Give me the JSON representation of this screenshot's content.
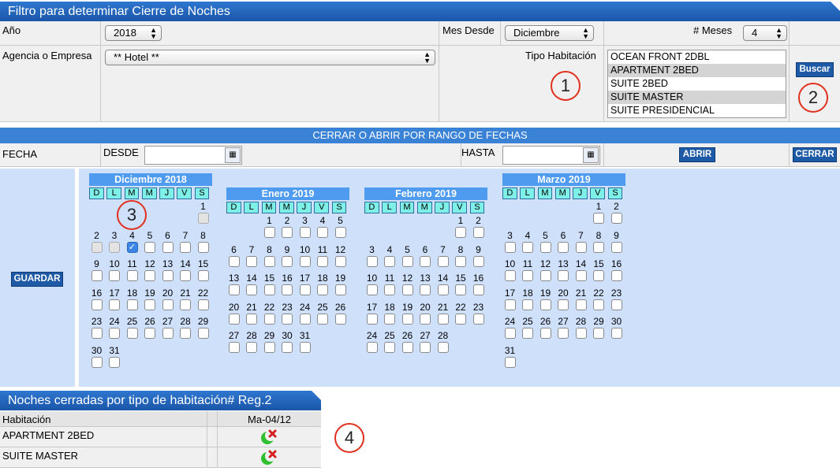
{
  "filter": {
    "title": "Filtro para determinar Cierre de Noches",
    "year_label": "Año",
    "year_value": "2018",
    "month_from_label": "Mes Desde",
    "month_from_value": "Diciembre",
    "months_label": "# Meses",
    "months_value": "4",
    "agency_label": "Agencia o Empresa",
    "agency_value": "** Hotel **",
    "room_type_label": "Tipo Habitación",
    "room_types": [
      {
        "label": "OCEAN FRONT 2DBL",
        "selected": false
      },
      {
        "label": "APARTMENT 2BED",
        "selected": true
      },
      {
        "label": "SUITE 2BED",
        "selected": false
      },
      {
        "label": "SUITE MASTER",
        "selected": true
      },
      {
        "label": "SUITE PRESIDENCIAL",
        "selected": false
      }
    ],
    "search_label": "Buscar"
  },
  "markers": [
    "1",
    "2",
    "3",
    "4"
  ],
  "range": {
    "title": "CERRAR O ABRIR POR RANGO DE FECHAS",
    "date_label": "FECHA",
    "from_label": "DESDE",
    "from_value": "",
    "to_label": "HASTA",
    "to_value": "",
    "open_label": "ABRIR",
    "close_label": "CERRAR"
  },
  "calendar": {
    "save_label": "GUARDAR",
    "dow": [
      "D",
      "L",
      "M",
      "M",
      "J",
      "V",
      "S"
    ],
    "months": [
      {
        "title": "Diciembre 2018",
        "start": 6,
        "days": 31,
        "disabled_upto": 3,
        "checked": [
          4
        ]
      },
      {
        "title": "Enero 2019",
        "start": 2,
        "days": 31,
        "disabled_upto": 0,
        "checked": []
      },
      {
        "title": "Febrero 2019",
        "start": 5,
        "days": 28,
        "disabled_upto": 0,
        "checked": []
      },
      {
        "title": "Marzo 2019",
        "start": 5,
        "days": 31,
        "disabled_upto": 0,
        "checked": []
      }
    ]
  },
  "closed": {
    "title": "Noches cerradas por tipo de habitación# Reg.2",
    "col_room": "Habitación",
    "col_date": "Ma-04/12",
    "rows": [
      {
        "room": "APARTMENT 2BED"
      },
      {
        "room": "SUITE MASTER"
      }
    ]
  }
}
